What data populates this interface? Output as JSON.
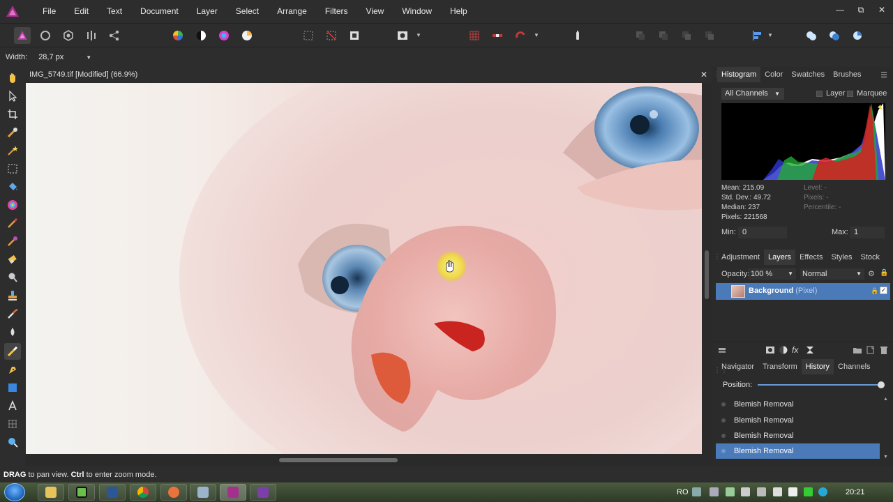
{
  "menu": {
    "items": [
      "File",
      "Edit",
      "Text",
      "Document",
      "Layer",
      "Select",
      "Arrange",
      "Filters",
      "View",
      "Window",
      "Help"
    ]
  },
  "window": {
    "minimize": "—",
    "restore": "⧉",
    "close": "✕"
  },
  "context": {
    "width_label": "Width:",
    "width_value": "28,7 px"
  },
  "document": {
    "title": "IMG_5749.tif [Modified] (66.9%)",
    "close": "✕"
  },
  "histogram_panel": {
    "tabs": [
      "Histogram",
      "Color",
      "Swatches",
      "Brushes"
    ],
    "channel": "All Channels",
    "layer_label": "Layer",
    "marquee_label": "Marquee",
    "stats": {
      "mean": "Mean: 215.09",
      "std": "Std. Dev.: 49.72",
      "median": "Median: 237",
      "pixels": "Pixels: 221568",
      "level": "Level: -",
      "pixels2": "Pixels: -",
      "percentile": "Percentile: -"
    },
    "min_label": "Min:",
    "min_value": "0",
    "max_label": "Max:",
    "max_value": "1"
  },
  "layers_panel": {
    "tabs": [
      "Adjustment",
      "Layers",
      "Effects",
      "Styles",
      "Stock"
    ],
    "opacity_label": "Opacity:",
    "opacity_value": "100 %",
    "blend_mode": "Normal",
    "layer_name": "Background",
    "layer_type": "(Pixel)"
  },
  "history_panel": {
    "tabs": [
      "Navigator",
      "Transform",
      "History",
      "Channels"
    ],
    "position_label": "Position:",
    "position_fraction": 1.0,
    "entries": [
      "Blemish Removal",
      "Blemish Removal",
      "Blemish Removal",
      "Blemish Removal"
    ]
  },
  "status": {
    "drag": "DRAG",
    "drag_text": " to pan view. ",
    "ctrl": "Ctrl",
    "ctrl_text": " to enter zoom mode."
  },
  "taskbar": {
    "language": "RO",
    "clock": "20:21"
  },
  "colors": {
    "accent": "#4a7ab8",
    "panel": "#2b2b2b",
    "app": "#a3318c"
  }
}
